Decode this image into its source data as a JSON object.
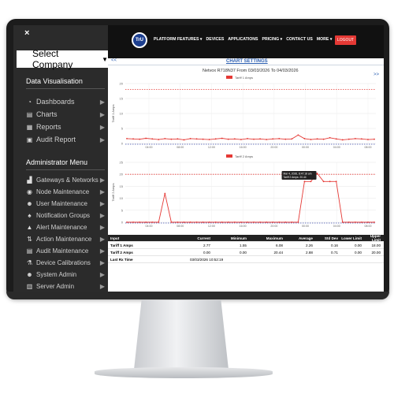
{
  "sidebar": {
    "close": "×",
    "company": "Select Company",
    "section1": "Data Visualisation",
    "section1_items": [
      {
        "label": "Dashboards",
        "icon": "dashboard-icon"
      },
      {
        "label": "Charts",
        "icon": "chart-icon"
      },
      {
        "label": "Reports",
        "icon": "report-icon"
      },
      {
        "label": "Audit Report",
        "icon": "document-icon"
      }
    ],
    "section2": "Administrator Menu",
    "section2_items": [
      {
        "label": "Gateways & Networks",
        "icon": "truck-icon"
      },
      {
        "label": "Node Maintenance",
        "icon": "node-icon"
      },
      {
        "label": "User Maintenance",
        "icon": "users-icon"
      },
      {
        "label": "Notification Groups",
        "icon": "bell-icon"
      },
      {
        "label": "Alert Maintenance",
        "icon": "warning-icon"
      },
      {
        "label": "Action Maintenance",
        "icon": "action-icon"
      },
      {
        "label": "Audit Maintenance",
        "icon": "audit-icon"
      },
      {
        "label": "Device Calibrations",
        "icon": "flask-icon"
      },
      {
        "label": "System Admin",
        "icon": "user-gear-icon"
      },
      {
        "label": "Server Admin",
        "icon": "server-icon"
      }
    ]
  },
  "topnav": {
    "logo": "TrU",
    "items": [
      "PLATFORM FEATURES ▾",
      "DEVICES",
      "APPLICATIONS",
      "PRICING ▾",
      "CONTACT US",
      "MORE ▾",
      "SHOP"
    ],
    "logout": "LOGOUT"
  },
  "content": {
    "prev": "<<",
    "next": ">>",
    "chart_settings": "CHART SETTINGS",
    "subtitle": "Netvox R718N37 From 03/03/2026 To 04/03/2026"
  },
  "chart_data": [
    {
      "type": "line",
      "series": [
        {
          "name": "Tariff 1 Amps",
          "color": "#e53935"
        }
      ],
      "ylabel": "Tariff 1 Amps",
      "ylim": [
        0,
        20
      ],
      "yticks": [
        "20",
        "15",
        "10",
        "5",
        "0"
      ],
      "xticks": [
        "04:00",
        "08:00",
        "12:00",
        "16:00",
        "20:00",
        "00:00",
        "04:00",
        "08:00"
      ],
      "upper_limit": 18,
      "lower_limit": 0,
      "values": [
        1.6,
        1.5,
        1.4,
        1.7,
        1.5,
        1.3,
        1.6,
        1.4,
        1.5,
        1.2,
        1.6,
        1.5,
        1.4,
        1.3,
        1.5,
        1.7,
        1.4,
        1.5,
        1.3,
        1.6,
        1.4,
        1.5,
        1.3,
        1.5,
        1.6,
        1.4,
        1.5,
        2.8,
        1.6,
        1.3,
        1.5,
        1.4,
        1.9,
        1.5,
        1.2,
        1.4,
        1.6,
        1.5,
        1.3,
        1.4
      ]
    },
    {
      "type": "line",
      "series": [
        {
          "name": "Tariff 2 Amps",
          "color": "#e53935"
        }
      ],
      "ylabel": "Tariff 2 Amps",
      "ylim": [
        0,
        25
      ],
      "yticks": [
        "25",
        "20",
        "15",
        "10",
        "5",
        "0"
      ],
      "xticks": [
        "04:00",
        "08:00",
        "12:00",
        "16:00",
        "20:00",
        "00:00",
        "04:00",
        "08:00"
      ],
      "upper_limit": 20,
      "lower_limit": 0,
      "values": [
        0,
        0,
        0,
        0,
        0,
        0,
        12,
        0,
        0,
        0,
        0,
        0,
        0,
        0,
        0,
        0,
        0,
        0,
        0,
        0,
        0,
        0,
        0,
        0,
        0,
        0,
        0,
        0,
        17,
        17,
        20.4,
        17,
        17,
        17,
        0,
        0,
        0,
        0,
        0,
        0
      ],
      "tooltip": [
        "Mar 4, 2026, 8:47:18 am",
        "Tariff 2 Amps: 20.44"
      ]
    }
  ],
  "table": {
    "headers": [
      "Input",
      "Current",
      "Minimum",
      "Maximum",
      "Average",
      "Std Dev",
      "Lower Limit",
      "Upper Limit"
    ],
    "rows": [
      [
        "Tariff 1 Amps",
        "2.77",
        "1.55",
        "6.08",
        "2.26",
        "0.16",
        "0.00",
        "18.00"
      ],
      [
        "Tariff 2 Amps",
        "0.00",
        "0.00",
        "20.44",
        "2.88",
        "0.71",
        "0.00",
        "20.00"
      ],
      [
        "Last Rx Time",
        "03/03/2026 10:52:19",
        "",
        "",
        "",
        "",
        "",
        ""
      ]
    ]
  }
}
